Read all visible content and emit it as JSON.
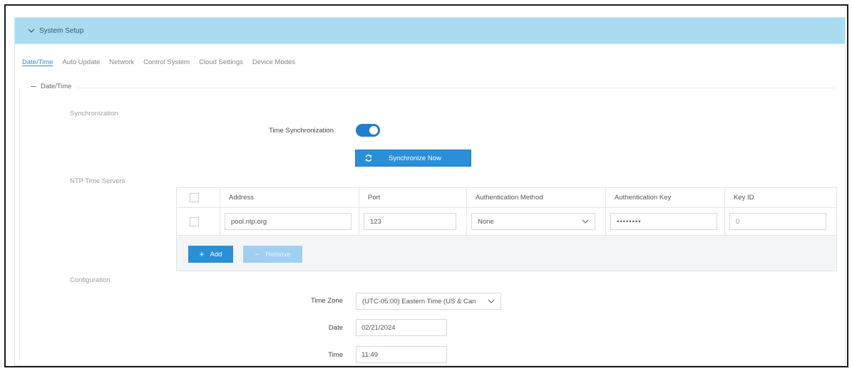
{
  "header": {
    "title": "System Setup",
    "icon": "chevron-down-icon"
  },
  "tabs": [
    {
      "label": "Date/Time",
      "active": true
    },
    {
      "label": "Auto Update",
      "active": false
    },
    {
      "label": "Network",
      "active": false
    },
    {
      "label": "Control System",
      "active": false
    },
    {
      "label": "Cloud Settings",
      "active": false
    },
    {
      "label": "Device Modes",
      "active": false
    }
  ],
  "section": {
    "legend": "Date/Time"
  },
  "synchronization": {
    "heading": "Synchronization",
    "toggle_label": "Time Synchronization",
    "toggle_on": true,
    "sync_button": "Synchronize Now"
  },
  "ntp": {
    "heading": "NTP Time Servers",
    "columns": [
      "Address",
      "Port",
      "Authentication Method",
      "Authentication Key",
      "Key ID"
    ],
    "rows": [
      {
        "address": "pool.ntp.org",
        "port": "123",
        "auth_method": "None",
        "auth_key": "••••••••",
        "key_id": "0"
      }
    ],
    "add_button": "Add",
    "remove_button": "Remove"
  },
  "configuration": {
    "heading": "Configuration",
    "time_zone_label": "Time Zone",
    "time_zone_value": "(UTC-05:00) Eastern Time (US & Can",
    "date_label": "Date",
    "date_value": "02/21/2024",
    "time_label": "Time",
    "time_value": "11:49"
  },
  "colors": {
    "header_bg": "#a9dcf1",
    "accent": "#2a8fd9",
    "tab_active": "#2f8ecc"
  }
}
